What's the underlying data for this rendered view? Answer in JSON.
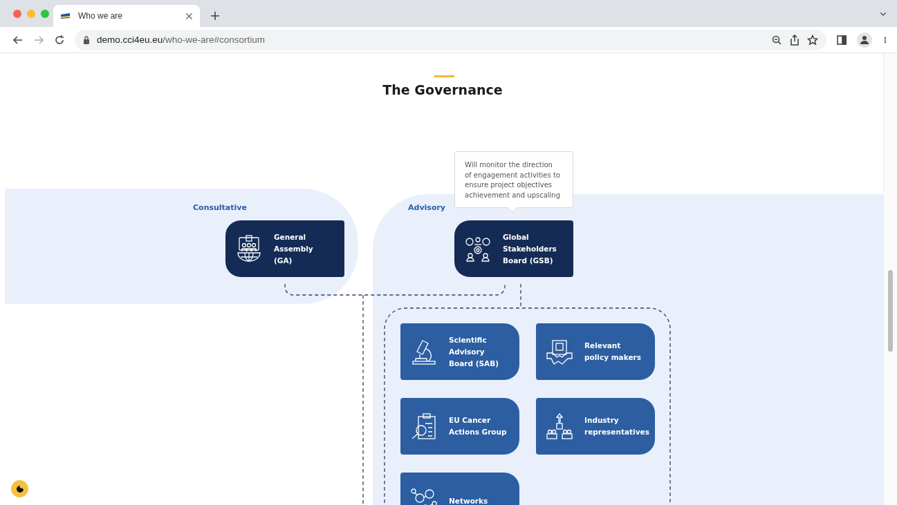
{
  "browser": {
    "tabs": [
      {
        "title": "Who we are",
        "selected": true
      }
    ],
    "url_domain": "demo.cci4eu.eu",
    "url_path": "/who-we-are#consortium"
  },
  "heading": "The Governance",
  "groups": [
    {
      "label": "Consultative"
    },
    {
      "label": "Advisory"
    }
  ],
  "tooltip": "Will monitor the direction\nof engagement activities to\nensure project objectives\nachievement and upscaling",
  "boards": [
    {
      "label": "General\nAssembly\n(GA)"
    },
    {
      "label": "Global\nStakeholders\nBoard (GSB)"
    }
  ],
  "members": [
    {
      "label": "Scientific\nAdvisory\nBoard (SAB)"
    },
    {
      "label": "Relevant\npolicy makers"
    },
    {
      "label": "EU Cancer\nActions Group"
    },
    {
      "label": "Industry\nrepresentatives"
    },
    {
      "label": "Networks"
    }
  ]
}
